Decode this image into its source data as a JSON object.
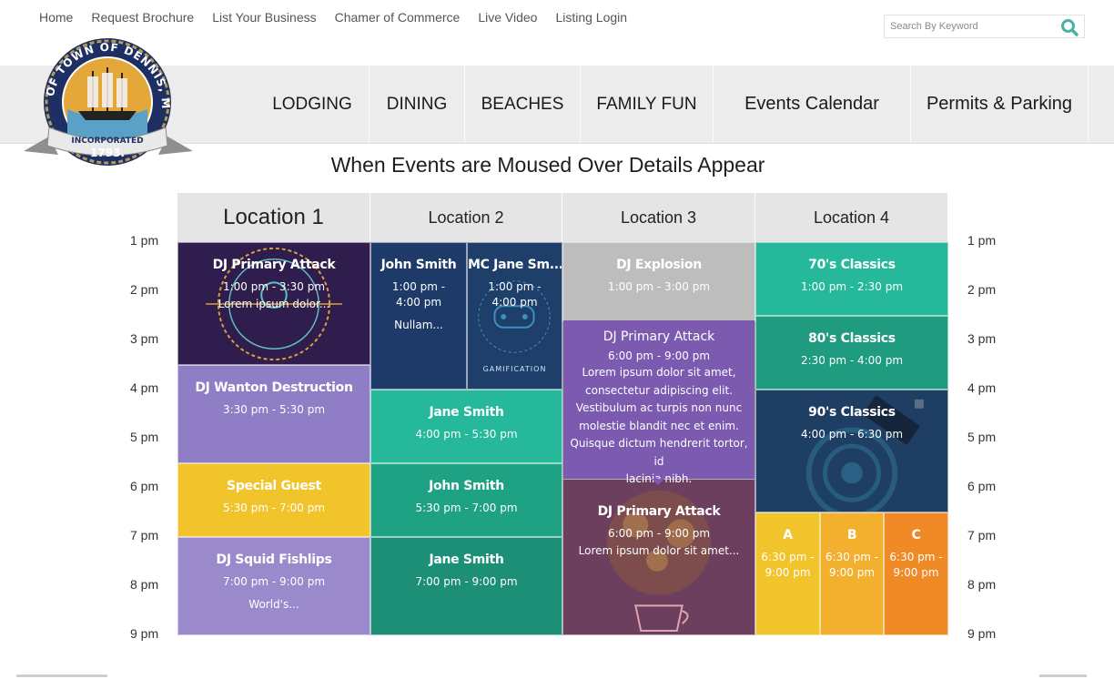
{
  "top_nav": {
    "items": [
      "Home",
      "Request Brochure",
      "List Your Business",
      "Chamer of Commerce",
      "Live Video",
      "Listing Login"
    ]
  },
  "search": {
    "placeholder": "Search By Keyword"
  },
  "seal": {
    "ring_text": "SEAL OF TOWN OF DENNIS, MASS",
    "ribbon_text": "INCORPORATED",
    "year": "1793."
  },
  "main_nav": {
    "items": [
      "LODGING",
      "DINING",
      "BEACHES",
      "FAMILY FUN",
      "Events Calendar",
      "Permits & Parking"
    ]
  },
  "demo_heading": "When Events are Moused Over Details Appear",
  "time_labels": [
    "1 pm",
    "2 pm",
    "3 pm",
    "4 pm",
    "5 pm",
    "6 pm",
    "7 pm",
    "8 pm",
    "9 pm"
  ],
  "locations": [
    "Location 1",
    "Location 2",
    "Location 3",
    "Location 4"
  ],
  "events": {
    "l1_dj_primary": {
      "title": "DJ Primary Attack",
      "time": "1:00 pm - 3:30 pm",
      "desc": "Lorem ipsum dolor..."
    },
    "l1_dj_wanton": {
      "title": "DJ Wanton Destruction",
      "time": "3:30 pm - 5:30 pm"
    },
    "l1_special_guest": {
      "title": "Special Guest",
      "time": "5:30 pm - 7:00 pm"
    },
    "l1_dj_squid": {
      "title": "DJ Squid Fishlips",
      "time": "7:00 pm - 9:00 pm",
      "desc": "World's..."
    },
    "l2_john_smith_a": {
      "title": "John Smith",
      "time": "1:00 pm - 4:00 pm",
      "desc": "Nullam..."
    },
    "l2_mc_jane": {
      "title": "MC Jane Sm...",
      "time": "1:00 pm - 4:00 pm",
      "art_label": "GAMIFICATION"
    },
    "l2_jane_smith_a": {
      "title": "Jane Smith",
      "time": "4:00 pm - 5:30 pm"
    },
    "l2_john_smith_b": {
      "title": "John Smith",
      "time": "5:30 pm - 7:00 pm"
    },
    "l2_jane_smith_b": {
      "title": "Jane Smith",
      "time": "7:00 pm - 9:00 pm"
    },
    "l3_dj_explosion": {
      "title": "DJ Explosion",
      "time": "1:00 pm - 3:00 pm"
    },
    "l3_dj_primary": {
      "title": "DJ Primary Attack",
      "time": "6:00 pm - 9:00 pm",
      "desc": "Lorem ipsum dolor sit amet..."
    },
    "l4_70s": {
      "title": "70's Classics",
      "time": "1:00 pm - 2:30 pm"
    },
    "l4_80s": {
      "title": "80's Classics",
      "time": "2:30 pm - 4:00 pm"
    },
    "l4_90s": {
      "title": "90's Classics",
      "time": "4:00 pm - 6:30 pm"
    },
    "l4_a": {
      "title": "A",
      "time": "6:30 pm - 9:00 pm"
    },
    "l4_b": {
      "title": "B",
      "time": "6:30 pm - 9:00 pm"
    },
    "l4_c": {
      "title": "C",
      "time": "6:30 pm - 9:00 pm"
    }
  },
  "tooltip": {
    "title": "DJ Primary Attack",
    "time": "6:00 pm - 9:00 pm",
    "lines": [
      "Lorem ipsum dolor sit amet,",
      "consectetur adipiscing elit.",
      "Vestibulum ac turpis non nunc",
      "molestie blandit nec et enim.",
      "Quisque dictum hendrerit tortor, id",
      "lacinia nibh."
    ]
  },
  "colors": {
    "dark_purple": "#2f1d4d",
    "lavender": "#8f7dc6",
    "yellow": "#f2c42c",
    "navy": "#1d3a68",
    "teal": "#26b89a",
    "dark_teal": "#1e8f77",
    "gray": "#bdbdbd",
    "tooltip_purple": "#7b5ab0",
    "coffee_purple": "#6c3f5f",
    "space_navy": "#1e3f63",
    "amber": "#f2b02e",
    "orange": "#f08a27",
    "search_teal": "#45b3a5"
  }
}
